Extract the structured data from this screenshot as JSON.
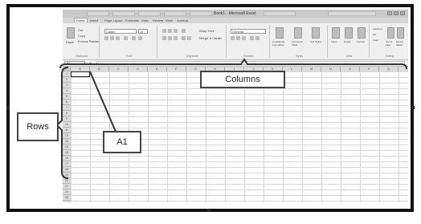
{
  "window": {
    "title": "Book1 - Microsoft Excel",
    "name_box": "A1",
    "formula_label": "fx"
  },
  "ribbon": {
    "tabs": [
      "Home",
      "Insert",
      "Page Layout",
      "Formulas",
      "Data",
      "Review",
      "View",
      "Acrobat"
    ],
    "font_name": "Calibri",
    "font_size": "11",
    "number_format": "General",
    "wrap_text_label": "Wrap Text",
    "merge_label": "Merge & Center",
    "paste_label": "Paste",
    "cut_label": "Cut",
    "copy_label": "Copy",
    "format_painter_label": "Format Painter",
    "group_clipboard": "Clipboard",
    "group_font": "Font",
    "group_alignment": "Alignment",
    "group_number": "Number",
    "group_styles": "Styles",
    "group_cells": "Cells",
    "group_editing": "Editing",
    "conditional_formatting_label": "Conditional Formatting",
    "format_as_table_label": "Format as Table",
    "cell_styles_label": "Cell Styles",
    "insert_label": "Insert",
    "delete_label": "Delete",
    "format_label": "Format",
    "autosum_label": "AutoSum",
    "fill_label": "Fill",
    "clear_label": "Clear",
    "sort_filter_label": "Sort & Filter",
    "find_select_label": "Find & Select"
  },
  "grid": {
    "columns": [
      "A",
      "B",
      "C",
      "D",
      "E",
      "F",
      "G",
      "H",
      "I",
      "J",
      "K",
      "L",
      "M",
      "N",
      "O",
      "P",
      "Q"
    ],
    "rows": [
      "1",
      "2",
      "3",
      "4",
      "5",
      "6",
      "7",
      "8",
      "9",
      "10",
      "11",
      "12",
      "13",
      "14",
      "15",
      "16",
      "17",
      "18",
      "19",
      "20",
      "21",
      "22",
      "23"
    ]
  },
  "callouts": {
    "columns": "Columns",
    "rows": "Rows",
    "cell": "A1"
  }
}
